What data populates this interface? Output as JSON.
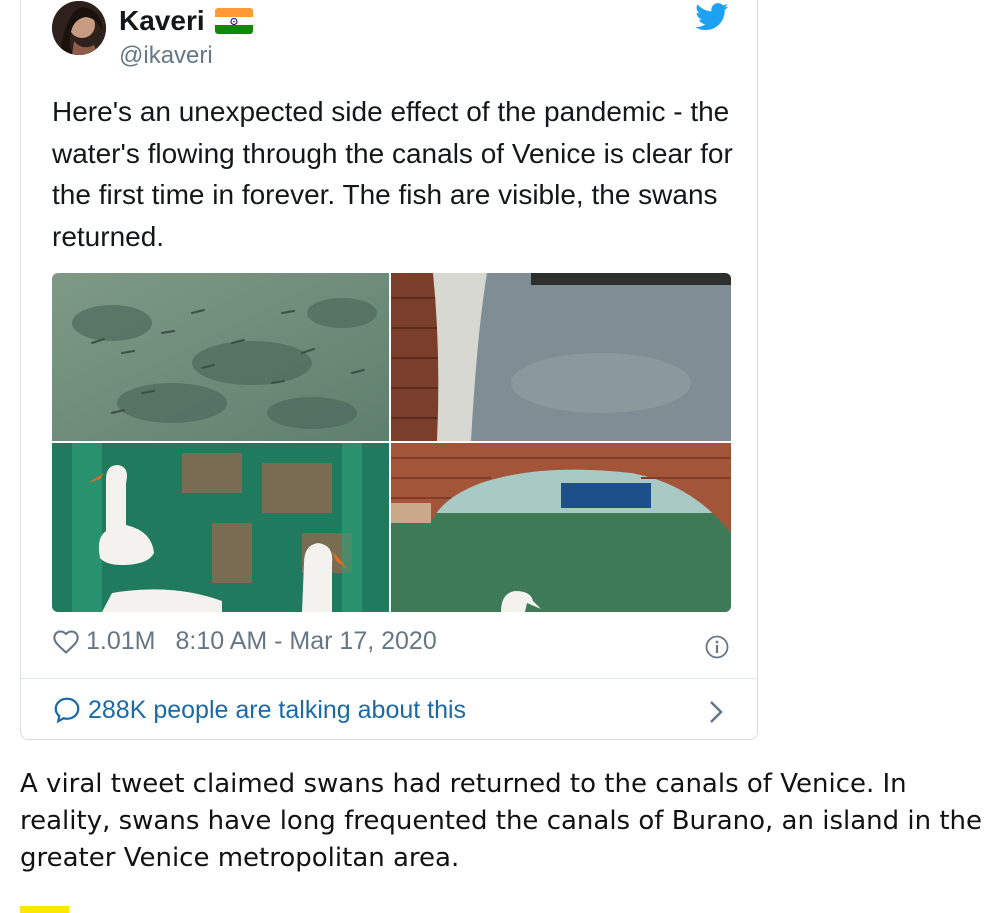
{
  "tweet": {
    "author_name": "Kaveri",
    "author_handle": "@ikaveri",
    "flag_icon": "india-flag-icon",
    "platform_icon": "twitter-bird-icon",
    "text": "Here's an unexpected side effect of the pandemic - the water's flowing through the canals of Venice is clear for the first time in forever. The fish are visible, the swans returned.",
    "photos": [
      {
        "alt": "fish-in-clear-canal-water"
      },
      {
        "alt": "clear-canal-water-by-brick-wall"
      },
      {
        "alt": "swans-in-green-canal"
      },
      {
        "alt": "brick-bridge-over-canal-with-swan"
      }
    ],
    "likes": "1.01M",
    "timestamp": "8:10 AM - Mar 17, 2020",
    "talking_label": "288K people are talking about this"
  },
  "caption": "A viral tweet claimed swans had returned to the canals of Venice. In reality, swans have long frequented the canals of Burano, an island in the greater Venice metropolitan area.",
  "colors": {
    "twitter_blue": "#1da1f2",
    "link_blue": "#1b6aa5",
    "muted_gray": "#657786",
    "accent_yellow": "#ffe500"
  }
}
